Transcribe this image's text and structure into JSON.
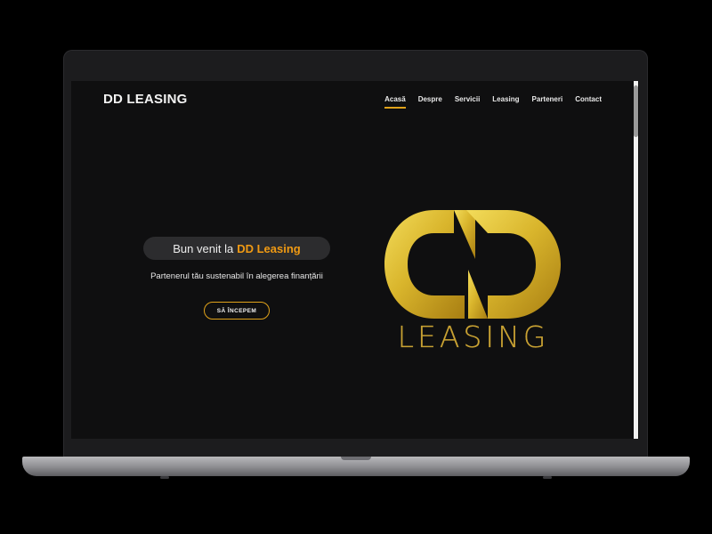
{
  "site": {
    "brand": "DD LEASING",
    "nav": [
      "Acasă",
      "Despre",
      "Servicii",
      "Leasing",
      "Parteneri",
      "Contact"
    ],
    "hero": {
      "welcome_prefix": "Bun venit la",
      "welcome_highlight": "DD Leasing",
      "tagline": "Partenerul tău sustenabil în alegerea finanțării",
      "cta_label": "SĂ ÎNCEPEM"
    },
    "logo_text": "LEASING"
  },
  "colors": {
    "accent": "#e0a21a",
    "highlight": "#f09a13",
    "gold": "#c9a233",
    "background": "#0f0f10"
  }
}
